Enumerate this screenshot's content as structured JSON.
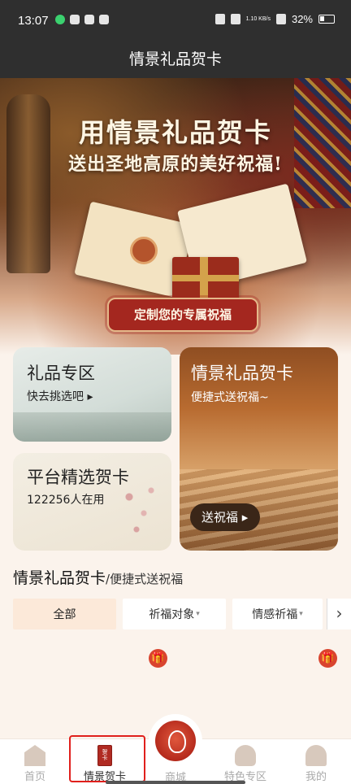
{
  "status_bar": {
    "time": "13:07",
    "network_speed": "1.10 KB/s",
    "battery": "32%"
  },
  "header": {
    "title": "情景礼品贺卡"
  },
  "banner": {
    "title": "用情景礼品贺卡",
    "subtitle": "送出圣地高原的美好祝福!",
    "cta_label": "定制您的专属祝福"
  },
  "tiles": {
    "gift_zone": {
      "title": "礼品专区",
      "subtitle": "快去挑选吧 ▸"
    },
    "platform_cards": {
      "title": "平台精选贺卡",
      "subtitle": "122256人在用"
    },
    "greeting_card": {
      "title": "情景礼品贺卡",
      "subtitle": "便捷式送祝福~",
      "button": "送祝福 ▸"
    }
  },
  "section": {
    "title": "情景礼品贺卡",
    "subtitle": "/便捷式送祝福"
  },
  "filters": [
    {
      "label": "全部",
      "active": true
    },
    {
      "label": "祈福对象",
      "caret": "▾"
    },
    {
      "label": "情感祈福",
      "caret": "▾"
    }
  ],
  "filter_more": "›",
  "tabbar": [
    {
      "label": "首页",
      "icon": "home-icon"
    },
    {
      "label": "情景贺卡",
      "icon": "greeting-card-icon",
      "active": true
    },
    {
      "label": "商城",
      "icon": "mall-icon"
    },
    {
      "label": "特色专区",
      "icon": "feature-icon"
    },
    {
      "label": "我的",
      "icon": "profile-icon"
    }
  ],
  "colors": {
    "accent": "#a4271f",
    "badge": "#d9442e",
    "highlight": "#e0201c"
  }
}
